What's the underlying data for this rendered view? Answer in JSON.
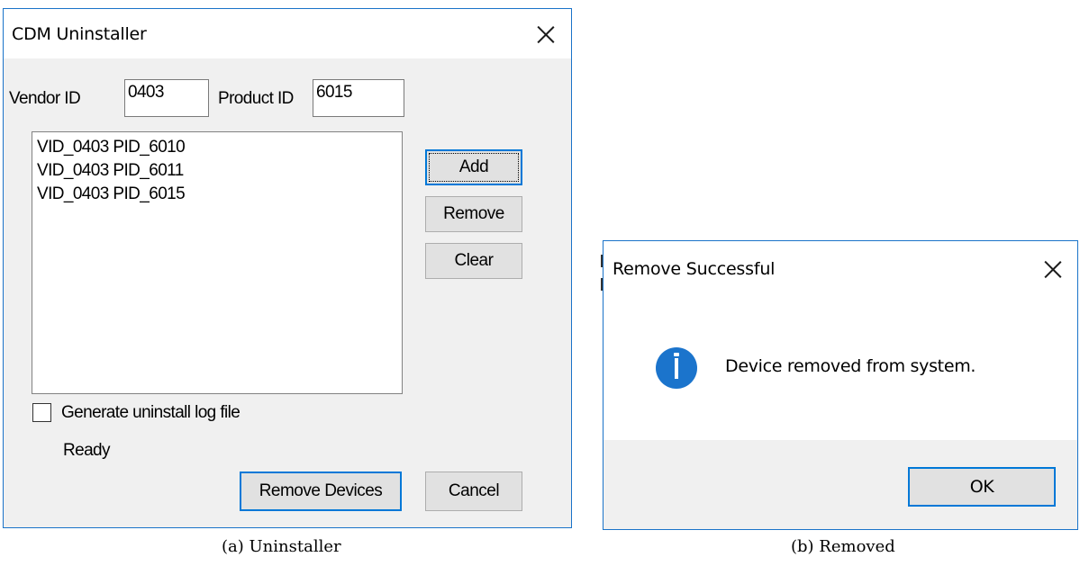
{
  "uninstaller": {
    "title": "CDM Uninstaller",
    "vendor_id_label": "Vendor ID",
    "vendor_id_value": "0403",
    "product_id_label": "Product ID",
    "product_id_value": "6015",
    "device_list": [
      "VID_0403 PID_6010",
      "VID_0403 PID_6011",
      "VID_0403 PID_6015"
    ],
    "add_label": "Add",
    "remove_label": "Remove",
    "clear_label": "Clear",
    "log_checkbox_label": "Generate uninstall log file",
    "log_checkbox_checked": false,
    "status_text": "Ready",
    "remove_devices_label": "Remove Devices",
    "cancel_label": "Cancel",
    "close_icon": "close-icon"
  },
  "message_box": {
    "title": "Remove Successful",
    "icon": "info-icon",
    "message": "Device removed from system.",
    "ok_label": "OK",
    "close_icon": "close-icon"
  },
  "captions": {
    "left": "(a) Uninstaller",
    "right": "(b) Removed"
  },
  "colors": {
    "window_border": "#1a73c9",
    "accent": "#0078d7",
    "info_icon": "#1b74cc",
    "dialog_bg": "#f0f0f0"
  }
}
